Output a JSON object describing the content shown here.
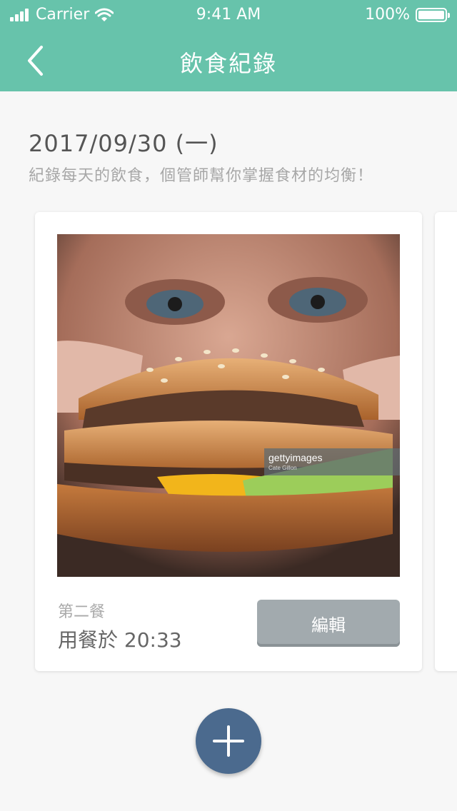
{
  "status_bar": {
    "carrier": "Carrier",
    "time": "9:41 AM",
    "battery": "100%"
  },
  "nav": {
    "title": "飲食紀錄",
    "back_icon": "chevron-left-icon"
  },
  "date": "2017/09/30 (一)",
  "subtitle": "紀錄每天的飲食，個管師幫你掌握食材的均衡！",
  "card": {
    "photo_alt": "burger photo",
    "watermark": "gettyimages",
    "photo_credit": "Cate Gillon",
    "meal_label": "第二餐",
    "meal_time": "用餐於 20:33",
    "edit_label": "編輯"
  },
  "fab": {
    "icon": "plus-icon"
  },
  "colors": {
    "header": "#67c3ab",
    "fab": "#4b6a8e",
    "edit_button": "#a2aaae"
  }
}
